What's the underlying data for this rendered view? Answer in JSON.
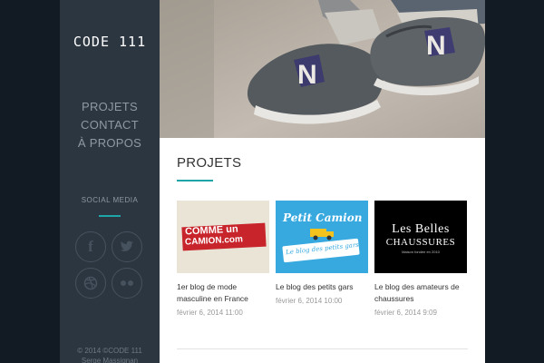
{
  "sidebar": {
    "logo": "CODE 111",
    "nav": [
      "PROJETS",
      "CONTACT",
      "À PROPOS"
    ],
    "social_title": "SOCIAL MEDIA",
    "social_icons": [
      "facebook-icon",
      "twitter-icon",
      "dribbble-icon",
      "flickr-icon"
    ],
    "copyright_line1": "© 2014 ©CODE 111",
    "copyright_line2": "Serge Massignan"
  },
  "main": {
    "section_title": "PROJETS",
    "projects": [
      {
        "thumb_line1": "COMME un",
        "thumb_line2": "CAMION.com",
        "title": "1er blog de mode masculine en France",
        "date": "février 6, 2014 11:00"
      },
      {
        "thumb_line1": "Petit Camion",
        "thumb_line2": "Le blog des petits gars",
        "title": "Le blog des petits gars",
        "date": "février 6, 2014 10:00"
      },
      {
        "thumb_line1": "Les Belles",
        "thumb_line2": "CHAUSSURES",
        "thumb_line3": "Maison fondée en 2010",
        "title": "Le blog des amateurs de chaussures",
        "date": "février 6, 2014 9:09"
      }
    ]
  },
  "colors": {
    "accent": "#1fa5a8",
    "sidebar_bg": "#2c3641",
    "page_bg": "#121a24"
  }
}
